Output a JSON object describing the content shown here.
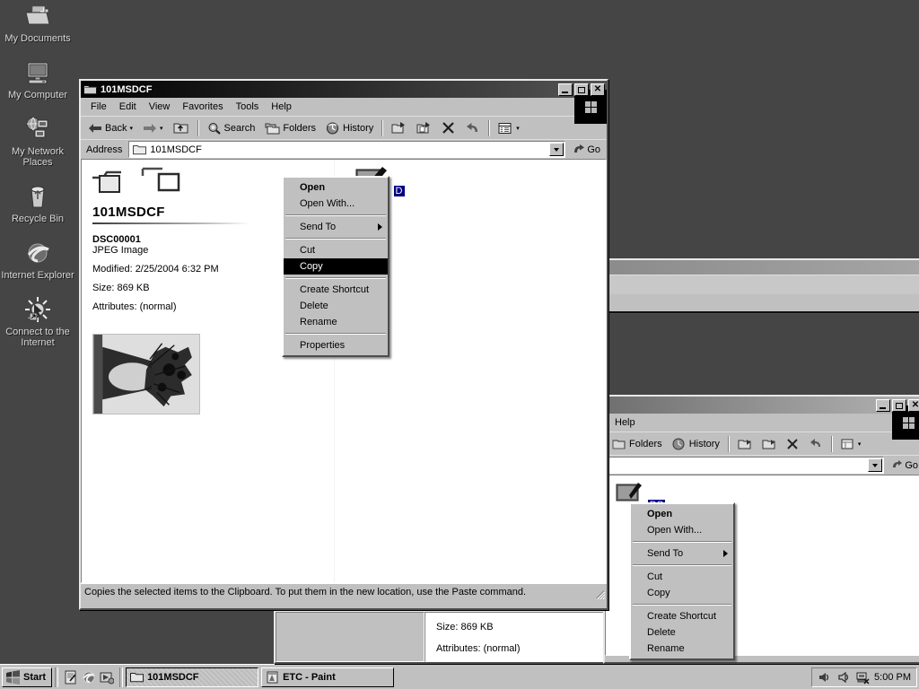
{
  "desktop": {
    "background_color": "#454545",
    "icons": [
      {
        "name": "my-documents",
        "label": "My Documents",
        "icon": "documents-folder-icon"
      },
      {
        "name": "my-computer",
        "label": "My Computer",
        "icon": "computer-icon"
      },
      {
        "name": "my-network-places",
        "label": "My Network Places",
        "icon": "network-icon"
      },
      {
        "name": "recycle-bin",
        "label": "Recycle Bin",
        "icon": "recycle-bin-icon"
      },
      {
        "name": "internet-explorer",
        "label": "Internet Explorer",
        "icon": "internet-explorer-icon"
      },
      {
        "name": "connect-to-the-internet",
        "label": "Connect to the Internet",
        "icon": "connect-wizard-icon"
      }
    ]
  },
  "explorer_window": {
    "title": "101MSDCF",
    "title_icon": "folder-icon",
    "window_buttons": {
      "minimize": "_",
      "maximize": "□",
      "close": "✕"
    },
    "menubar": [
      "File",
      "Edit",
      "View",
      "Favorites",
      "Tools",
      "Help"
    ],
    "toolbar": {
      "back": "Back",
      "forward": "",
      "up": "",
      "search": "Search",
      "folders": "Folders",
      "history": "History",
      "move_to": "",
      "copy_to": "",
      "delete": "",
      "undo": "",
      "views": ""
    },
    "address": {
      "label": "Address",
      "value": "101MSDCF",
      "go_label": "Go"
    },
    "info_panel": {
      "folder_name": "101MSDCF",
      "file_name": "DSC00001",
      "file_type": "JPEG Image",
      "modified": "Modified: 2/25/2004 6:32 PM",
      "size": "Size: 869 KB",
      "attributes": "Attributes: (normal)"
    },
    "file_list": [
      {
        "name": "DSC00001",
        "selected": true
      }
    ],
    "status_text": "Copies the selected items to the Clipboard. To put them in the new location, use the Paste command."
  },
  "context_menu": {
    "items": [
      {
        "label": "Open",
        "bold": true,
        "selected": false,
        "submenu": false
      },
      {
        "label": "Open With...",
        "bold": false,
        "selected": false,
        "submenu": false
      },
      {
        "separator": true
      },
      {
        "label": "Send To",
        "bold": false,
        "selected": false,
        "submenu": true
      },
      {
        "separator": true
      },
      {
        "label": "Cut",
        "bold": false,
        "selected": false,
        "submenu": false
      },
      {
        "label": "Copy",
        "bold": false,
        "selected": true,
        "submenu": false
      },
      {
        "separator": true
      },
      {
        "label": "Create Shortcut",
        "bold": false,
        "selected": false,
        "submenu": false
      },
      {
        "label": "Delete",
        "bold": false,
        "selected": false,
        "submenu": false
      },
      {
        "label": "Rename",
        "bold": false,
        "selected": false,
        "submenu": false
      },
      {
        "separator": true
      },
      {
        "label": "Properties",
        "bold": false,
        "selected": false,
        "submenu": false
      }
    ]
  },
  "background_window": {
    "menubar_last": "Help",
    "toolbar": {
      "folders": "Folders",
      "history": "History"
    },
    "address_go": "Go",
    "file_label": "DS",
    "context_menu": {
      "items": [
        {
          "label": "Open",
          "bold": true,
          "submenu": false
        },
        {
          "label": "Open With...",
          "bold": false,
          "submenu": false
        },
        {
          "separator": true
        },
        {
          "label": "Send To",
          "bold": false,
          "submenu": true
        },
        {
          "separator": true
        },
        {
          "label": "Cut",
          "bold": false,
          "submenu": false
        },
        {
          "label": "Copy",
          "bold": false,
          "submenu": false
        },
        {
          "separator": true
        },
        {
          "label": "Create Shortcut",
          "bold": false,
          "submenu": false
        },
        {
          "label": "Delete",
          "bold": false,
          "submenu": false
        },
        {
          "label": "Rename",
          "bold": false,
          "submenu": false
        }
      ]
    }
  },
  "third_window": {
    "size": "Size: 869 KB",
    "attributes": "Attributes: (normal)",
    "desktop_icon_label": "Internet Explorer"
  },
  "taskbar": {
    "start_label": "Start",
    "quick_launch": [
      "show-desktop-icon",
      "internet-explorer-icon",
      "media-player-icon"
    ],
    "tasks": [
      {
        "label": "101MSDCF",
        "icon": "folder-icon",
        "active": true
      },
      {
        "label": "ETC - Paint",
        "icon": "paint-icon",
        "active": false
      }
    ],
    "tray_icons": [
      "volume-icon",
      "sound-icon",
      "network-status-icon"
    ],
    "clock": "5:00 PM"
  }
}
